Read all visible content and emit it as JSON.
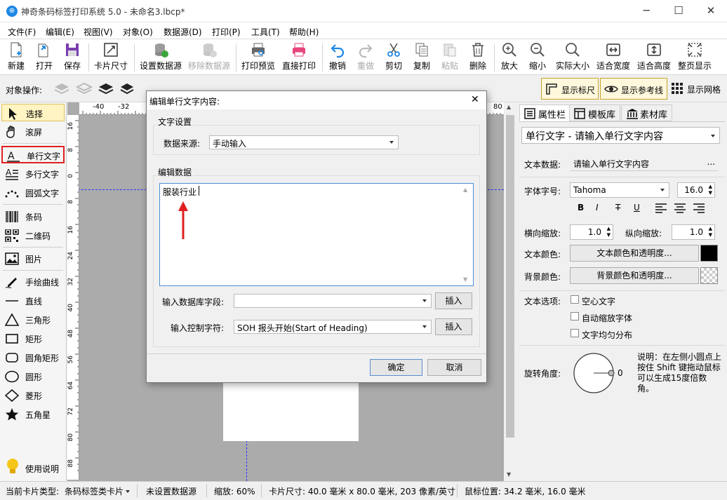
{
  "window": {
    "title": "神奇条码标签打印系统 5.0 - 未命名3.lbcp*",
    "app_icon_glyph": "⊕"
  },
  "menu": [
    "文件(F)",
    "编辑(E)",
    "视图(V)",
    "对象(O)",
    "数据源(D)",
    "打印(P)",
    "工具(T)",
    "帮助(H)"
  ],
  "toolbar": {
    "new": "新建",
    "open": "打开",
    "save": "保存",
    "card_size": "卡片尺寸",
    "set_datasource": "设置数据源",
    "remove_datasource": "移除数据源",
    "print_preview": "打印预览",
    "direct_print": "直接打印",
    "undo": "撤销",
    "redo": "重做",
    "cut": "剪切",
    "copy": "复制",
    "paste": "粘贴",
    "delete": "删除",
    "zoom_in": "放大",
    "zoom_out": "缩小",
    "actual_size": "实际大小",
    "fit_width": "适合宽度",
    "fit_height": "适合高度",
    "full_page": "整页显示"
  },
  "objbar": {
    "label": "对象操作:",
    "show_ruler": "显示标尺",
    "show_guides": "显示参考线",
    "show_grid": "显示网格"
  },
  "left_tools": [
    {
      "label": "选择",
      "icon": "arrow-icon"
    },
    {
      "label": "滚屏",
      "icon": "hand-icon"
    },
    {
      "label": "单行文字",
      "icon": "single-text-icon"
    },
    {
      "label": "多行文字",
      "icon": "multi-text-icon"
    },
    {
      "label": "圆弧文字",
      "icon": "arc-text-icon"
    },
    {
      "label": "条码",
      "icon": "barcode-icon"
    },
    {
      "label": "二维码",
      "icon": "qrcode-icon"
    },
    {
      "label": "图片",
      "icon": "image-icon"
    },
    {
      "label": "手绘曲线",
      "icon": "pen-icon"
    },
    {
      "label": "直线",
      "icon": "line-icon"
    },
    {
      "label": "三角形",
      "icon": "triangle-icon"
    },
    {
      "label": "矩形",
      "icon": "rect-icon"
    },
    {
      "label": "圆角矩形",
      "icon": "round-rect-icon"
    },
    {
      "label": "圆形",
      "icon": "circle-icon"
    },
    {
      "label": "菱形",
      "icon": "diamond-icon"
    },
    {
      "label": "五角星",
      "icon": "star-icon"
    },
    {
      "label": "使用说明",
      "icon": "bulb-icon"
    }
  ],
  "ruler": {
    "h_ticks": [
      "-40",
      "-32",
      "80"
    ],
    "v_ticks": [
      "16",
      "8",
      "0",
      "8",
      "16",
      "24",
      "32",
      "40",
      "48",
      "56",
      "64",
      "72",
      "80",
      "88"
    ]
  },
  "right_panel": {
    "tabs": [
      "属性栏",
      "模板库",
      "素材库"
    ],
    "object_select": "单行文字 - 请输入单行文字内容",
    "text_data_label": "文本数据:",
    "text_data_value": "请输入单行文字内容",
    "ellipsis": "...",
    "font_label": "字体字号:",
    "font_name": "Tahoma",
    "font_size": "16.0",
    "hscale_label": "横向缩放:",
    "hscale": "1.0",
    "vscale_label": "纵向缩放:",
    "vscale": "1.0",
    "text_color_label": "文本颜色:",
    "text_color_btn": "文本颜色和透明度...",
    "bg_color_label": "背景颜色:",
    "bg_color_btn": "背景颜色和透明度...",
    "text_options_label": "文本选项:",
    "opt_hollow": "空心文字",
    "opt_autoscale": "自动缩放字体",
    "opt_even": "文字均匀分布",
    "rotate_label": "旋转角度:",
    "rotate_value": "0",
    "rotate_note": "说明：在左侧小圆点上按住 Shift 键拖动鼠标可以生成15度倍数角。",
    "style_b": "B",
    "style_i": "I",
    "style_s": "T",
    "style_u": "U",
    "text_color": "#000000"
  },
  "dialog": {
    "title": "编辑单行文字内容:",
    "close": "✕",
    "group_text_settings": "文字设置",
    "datasource_label": "数据来源:",
    "datasource_value": "手动输入",
    "group_edit_data": "编辑数据",
    "textarea_value": "服装行业",
    "db_field_label": "输入数据库字段:",
    "db_field_value": "",
    "insert1": "插入",
    "ctrl_char_label": "输入控制字符:",
    "ctrl_char_value": "SOH  报头开始(Start of Heading)",
    "insert2": "插入",
    "ok": "确定",
    "cancel": "取消"
  },
  "status": {
    "card_type_label": "当前卡片类型:",
    "card_type": "条码标签类卡片",
    "datasource": "未设置数据源",
    "zoom": "缩放: 60%",
    "card_size": "卡片尺寸: 40.0 毫米 x 80.0 毫米, 203 像素/英寸",
    "mouse_pos": "鼠标位置: 34.2 毫米, 16.0 毫米"
  },
  "colors": {
    "accent": "#1e88e5",
    "annotation_red": "#e02020",
    "canvas_bg": "#ababab",
    "guide": "#3030ff"
  }
}
